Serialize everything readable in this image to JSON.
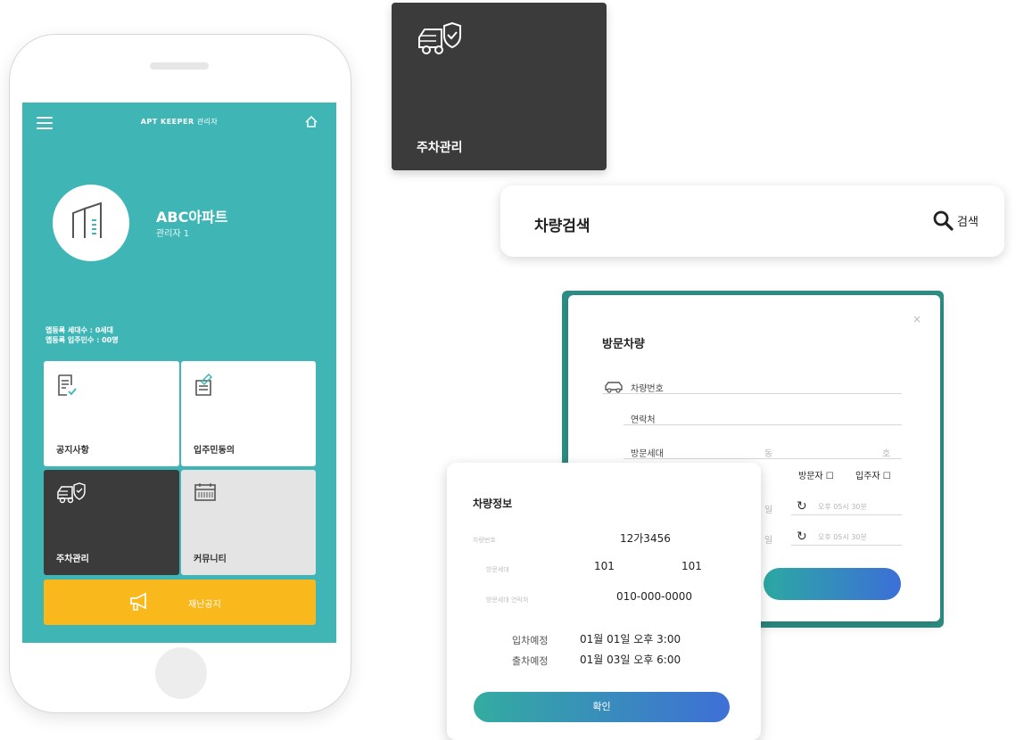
{
  "phone": {
    "brand_bold": "APT KEEPER",
    "brand_suffix": "관리자",
    "apt_name": "ABC아파트",
    "apt_role": "관리자 1",
    "stat_households": "앱등록 세대수 : 0세대",
    "stat_residents": "앱등록 입주민수 : 00명",
    "tiles": [
      {
        "label": "공지사항",
        "icon": "document-check-icon"
      },
      {
        "label": "입주민동의",
        "icon": "signature-form-icon"
      },
      {
        "label": "주차관리",
        "icon": "car-shield-icon"
      },
      {
        "label": "커뮤니티",
        "icon": "calendar-icon"
      }
    ],
    "notice_label": "재난공지",
    "notice_icon": "megaphone-icon"
  },
  "parking_card": {
    "label": "주차관리",
    "icon": "car-shield-icon"
  },
  "search_bar": {
    "title": "차량검색",
    "button_label": "검색",
    "icon": "search-icon"
  },
  "visitor_dialog": {
    "title": "방문차량",
    "close": "×",
    "car_number_label": "차량번호",
    "contact_label": "연락처",
    "household_label": "방문세대",
    "dong": "동",
    "ho": "호",
    "visitor_check": "방문자 ☐",
    "resident_check": "입주자 ☐",
    "date_suffix": "일",
    "time_placeholder": "오후 05시 30분"
  },
  "info_dialog": {
    "title": "차량정보",
    "car_number_label": "차량번호",
    "car_number": "12가3456",
    "household_label": "방문세대",
    "dong_value": "101",
    "ho_value": "101",
    "contact_label": "방문세대 연락처",
    "contact_value": "010-000-0000",
    "entry_label": "입차예정",
    "entry_value": "01월 01일 오후 3:00",
    "exit_label": "출차예정",
    "exit_value": "01월 03일 오후 6:00",
    "confirm_label": "확인"
  },
  "colors": {
    "teal": "#3fb6b5",
    "dark": "#3b3b3b",
    "yellow": "#f9b81c",
    "blue": "#3c6fd8"
  }
}
